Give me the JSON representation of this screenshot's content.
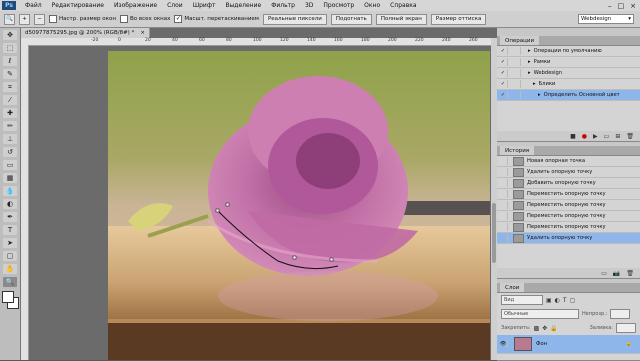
{
  "app": {
    "logo": "Ps",
    "menu": [
      "Файл",
      "Редактирование",
      "Изображение",
      "Слои",
      "Шрифт",
      "Выделение",
      "Фильтр",
      "3D",
      "Просмотр",
      "Окно",
      "Справка"
    ]
  },
  "options": {
    "checkbox_resize": "Настр. размер окон",
    "checkbox_all_windows": "Во всех окнах",
    "checkbox_scrubby": "Масшт. перетаскиванием",
    "btn_actual_pixels": "Реальные пиксели",
    "btn_fit": "Подогнать",
    "btn_fullscreen": "Полный экран",
    "btn_print_size": "Размер оттиска",
    "workspace": "Webdesign"
  },
  "document": {
    "tab_title": "d50977875295.jpg @ 200% (RGB/8#) *",
    "ruler_labels": [
      "-20",
      "0",
      "20",
      "40",
      "60",
      "80",
      "100",
      "120",
      "140",
      "160",
      "180",
      "200",
      "220",
      "240",
      "260"
    ]
  },
  "actions_panel": {
    "title": "Операции",
    "rows": [
      {
        "label": "Операции по умолчанию",
        "indent": 1,
        "selected": false
      },
      {
        "label": "Рамки",
        "indent": 1,
        "selected": false
      },
      {
        "label": "Webdesign",
        "indent": 1,
        "selected": false
      },
      {
        "label": "Блики",
        "indent": 2,
        "selected": false
      },
      {
        "label": "Определить Основной цвет",
        "indent": 3,
        "selected": true
      }
    ]
  },
  "history_panel": {
    "title": "История",
    "rows": [
      {
        "label": "Новая опорная точка",
        "selected": false
      },
      {
        "label": "Удалить опорную точку",
        "selected": false
      },
      {
        "label": "Добавить опорную точку",
        "selected": false
      },
      {
        "label": "Переместить опорную точку",
        "selected": false
      },
      {
        "label": "Переместить опорную точку",
        "selected": false
      },
      {
        "label": "Переместить опорную точку",
        "selected": false
      },
      {
        "label": "Переместить опорную точку",
        "selected": false
      },
      {
        "label": "Удалить опорную точку",
        "selected": true
      }
    ]
  },
  "layers_panel": {
    "title": "Слои",
    "kind": "Вид",
    "blend_mode": "Обычные",
    "opacity_label": "Непрозр.:",
    "lock_label": "Закрепить:",
    "fill_label": "Заливка:",
    "layer_name": "Фон"
  },
  "colors": {
    "menu_bg": "#d6d6d6",
    "panel_bg": "#d4d4d4",
    "selection": "#8fb6ea",
    "canvas_bg": "#6b6b6b"
  }
}
